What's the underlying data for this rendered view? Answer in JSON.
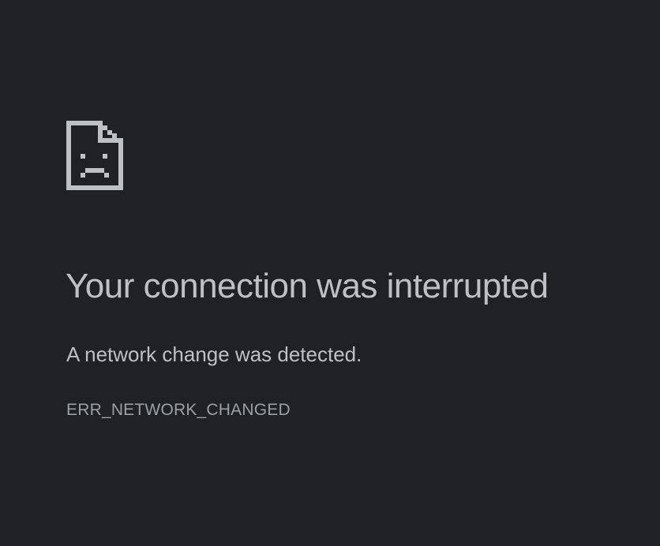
{
  "error_page": {
    "icon": "sad-document-icon",
    "title": "Your connection was interrupted",
    "message": "A network change was detected.",
    "error_code": "ERR_NETWORK_CHANGED"
  },
  "colors": {
    "background": "#202124",
    "text_primary": "#bdc1c6",
    "text_secondary": "#9aa0a6"
  }
}
